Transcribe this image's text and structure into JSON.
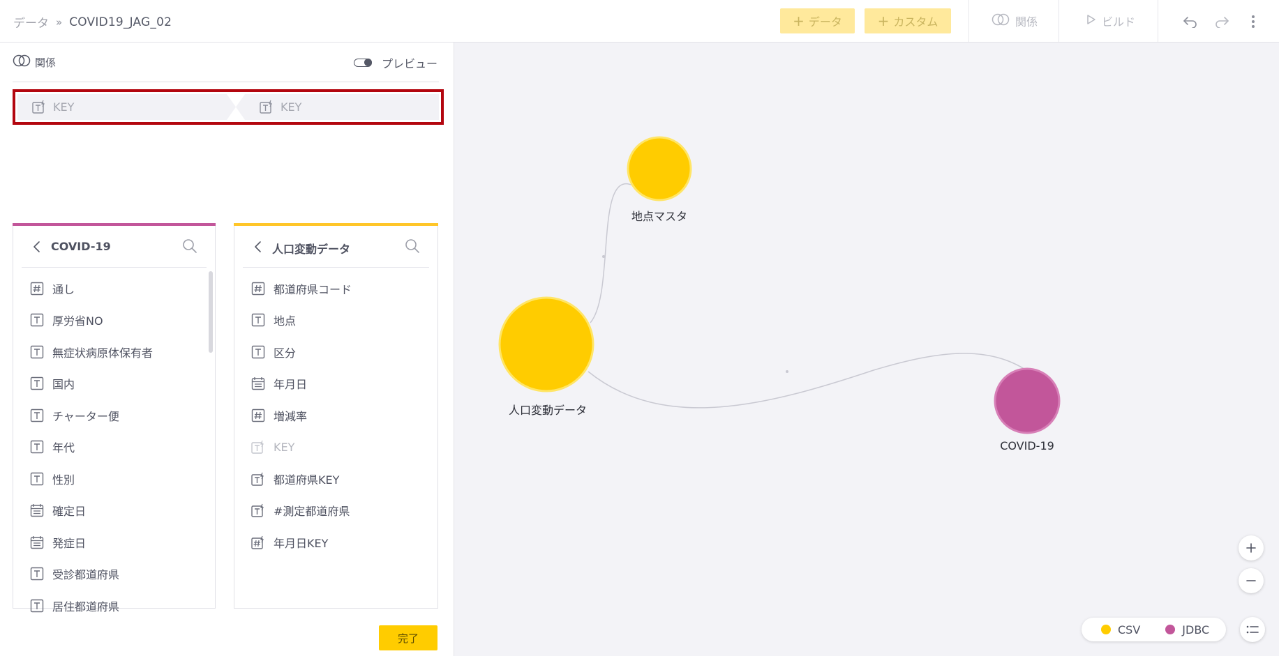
{
  "breadcrumb": {
    "root": "データ",
    "separator": "»",
    "current": "COVID19_JAG_02"
  },
  "toolbar": {
    "add_data_label": "データ",
    "add_custom_label": "カスタム",
    "relation_label": "関係",
    "build_label": "ビルド"
  },
  "relation_panel": {
    "title": "関係",
    "preview_label": "プレビュー",
    "preview_enabled": false,
    "join": {
      "left_field": "KEY",
      "right_field": "KEY"
    },
    "done_label": "完了"
  },
  "tables": {
    "left": {
      "name": "COVID-19",
      "accent": "#c2569a",
      "fields": [
        {
          "type": "number",
          "label": "通し"
        },
        {
          "type": "text",
          "label": "厚労省NO"
        },
        {
          "type": "text",
          "label": "無症状病原体保有者"
        },
        {
          "type": "text",
          "label": "国内"
        },
        {
          "type": "text",
          "label": "チャーター便"
        },
        {
          "type": "text",
          "label": "年代"
        },
        {
          "type": "text",
          "label": "性別"
        },
        {
          "type": "date",
          "label": "確定日"
        },
        {
          "type": "date",
          "label": "発症日"
        },
        {
          "type": "text",
          "label": "受診都道府県"
        },
        {
          "type": "text",
          "label": "居住都道府県"
        }
      ]
    },
    "right": {
      "name": "人口変動データ",
      "accent": "#ffc629",
      "fields": [
        {
          "type": "number",
          "label": "都道府県コード"
        },
        {
          "type": "text",
          "label": "地点"
        },
        {
          "type": "text",
          "label": "区分"
        },
        {
          "type": "date",
          "label": "年月日"
        },
        {
          "type": "number",
          "label": "増減率"
        },
        {
          "type": "text-custom",
          "label": "KEY",
          "dim": true
        },
        {
          "type": "text-custom",
          "label": "都道府県KEY"
        },
        {
          "type": "text-custom",
          "label": "#測定都道府県"
        },
        {
          "type": "number-custom",
          "label": "年月日KEY"
        }
      ]
    }
  },
  "graph": {
    "nodes": [
      {
        "id": "chiten",
        "label": "地点マスタ",
        "source": "CSV"
      },
      {
        "id": "jinko",
        "label": "人口変動データ",
        "source": "CSV"
      },
      {
        "id": "covid",
        "label": "COVID-19",
        "source": "JDBC"
      }
    ],
    "edges": [
      [
        "jinko",
        "chiten"
      ],
      [
        "jinko",
        "covid"
      ]
    ]
  },
  "legend": [
    {
      "label": "CSV",
      "color": "#ffcc00"
    },
    {
      "label": "JDBC",
      "color": "#c2569a"
    }
  ]
}
